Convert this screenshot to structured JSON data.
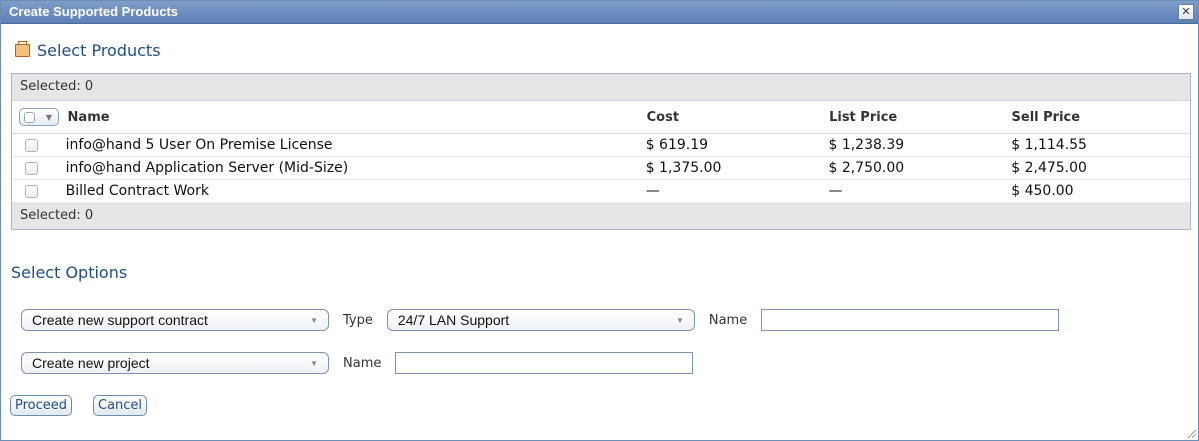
{
  "dialog": {
    "title": "Create Supported Products",
    "close_glyph": "✕"
  },
  "products": {
    "section_title": "Select Products",
    "selected_text_top": "Selected: 0",
    "selected_text_bottom": "Selected: 0",
    "columns": {
      "name": "Name",
      "cost": "Cost",
      "list_price": "List Price",
      "sell_price": "Sell Price"
    },
    "rows": [
      {
        "name": "info@hand 5 User On Premise License",
        "cost": "$ 619.19",
        "list_price": "$ 1,238.39",
        "sell_price": "$ 1,114.55"
      },
      {
        "name": "info@hand Application Server (Mid-Size)",
        "cost": "$ 1,375.00",
        "list_price": "$ 2,750.00",
        "sell_price": "$ 2,475.00"
      },
      {
        "name": "Billed Contract Work",
        "cost": "—",
        "list_price": "—",
        "sell_price": "$ 450.00"
      }
    ]
  },
  "options": {
    "section_title": "Select Options",
    "contract_select": "Create new support contract",
    "type_label": "Type",
    "type_select": "24/7 LAN Support",
    "contract_name_label": "Name",
    "contract_name_value": "",
    "project_select": "Create new project",
    "project_name_label": "Name",
    "project_name_value": ""
  },
  "buttons": {
    "proceed": "Proceed",
    "cancel": "Cancel"
  }
}
